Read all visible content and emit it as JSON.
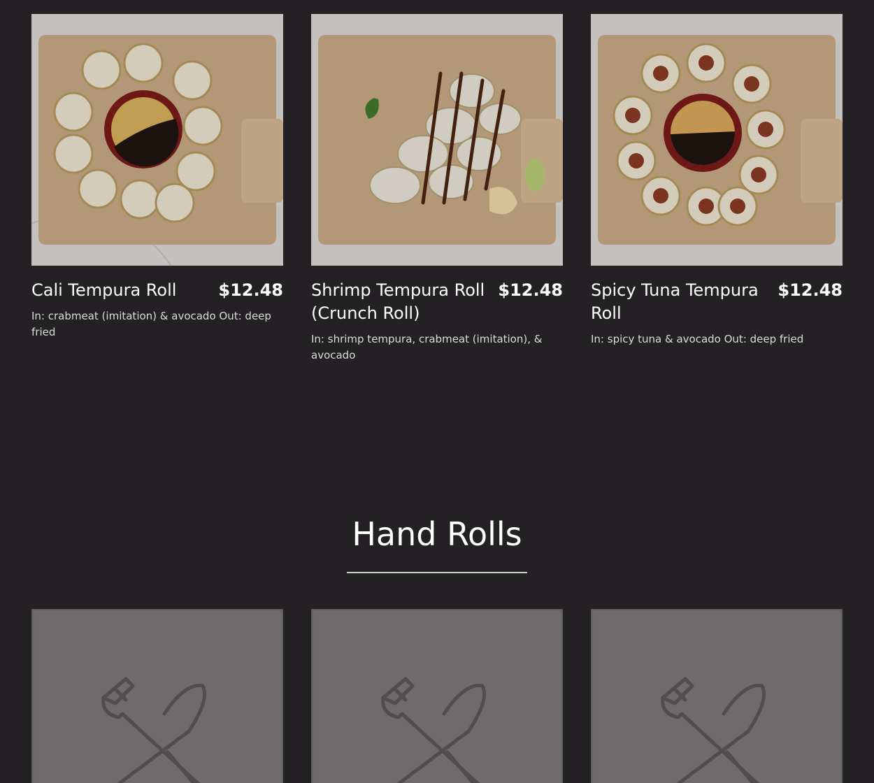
{
  "tempura_rolls": [
    {
      "name": "Cali Tempura Roll",
      "price": "$12.48",
      "description": "In: crabmeat (imitation) & avocado Out: deep fried"
    },
    {
      "name": "Shrimp Tempura Roll (Crunch Roll)",
      "price": "$12.48",
      "description": "In: shrimp tempura, crabmeat (imitation), & avocado"
    },
    {
      "name": "Spicy Tuna Tempura Roll",
      "price": "$12.48",
      "description": "In: spicy tuna & avocado Out: deep fried"
    }
  ],
  "hand_rolls": {
    "title": "Hand Rolls",
    "placeholder_icon": "fork-knife-icon"
  },
  "colors": {
    "background": "#232123",
    "text": "#ffffff",
    "placeholder": "#6d6b6c"
  }
}
